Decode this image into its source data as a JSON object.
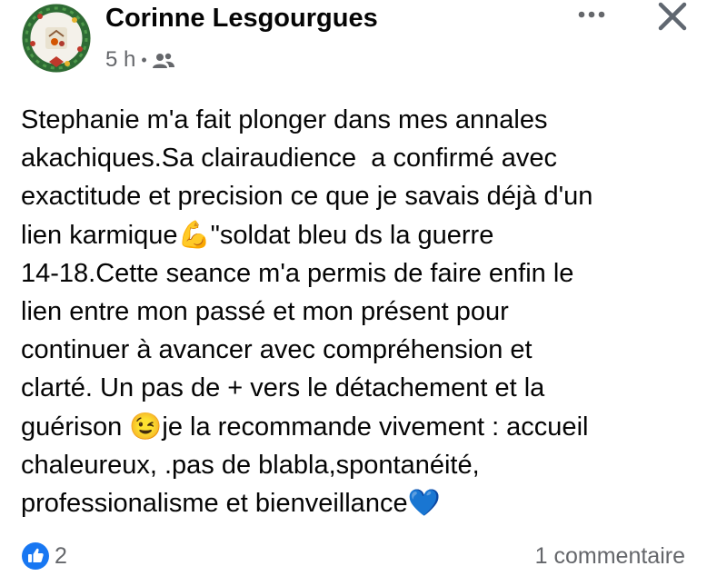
{
  "post": {
    "author": "Corinne Lesgourgues",
    "time": "5 h",
    "separator": "•",
    "audience_icon": "friends-icon",
    "text": "Stephanie m'a fait plonger dans mes annales\nakachiques.Sa clairaudience  a confirmé avec\nexactitude et precision ce que je savais déjà d'un\nlien karmique💪\"soldat bleu ds la guerre\n14-18.Cette seance m'a permis de faire enfin le\nlien entre mon passé et mon présent pour\ncontinuer à avancer avec compréhension et\nclarté. Un pas de + vers le détachement et la\nguérison 😉je la recommande vivement : accueil\nchaleureux, .pas de blabla,spontanéité,\nprofessionalisme et bienveillance💙"
  },
  "reactions": {
    "icon": "like-icon",
    "count": "2",
    "color": "#1877f2"
  },
  "comments": {
    "label": "1 commentaire"
  },
  "header_actions": {
    "more_icon": "more-options-icon",
    "close_icon": "close-icon"
  }
}
